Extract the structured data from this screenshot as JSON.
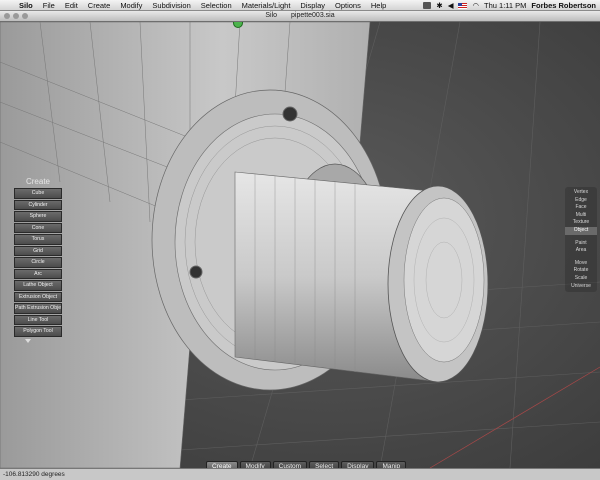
{
  "menubar": {
    "app_name": "Silo",
    "items": [
      "File",
      "Edit",
      "Create",
      "Modify",
      "Subdivision",
      "Selection",
      "Materials/Light",
      "Display",
      "Options",
      "Help"
    ],
    "clock": "Thu 1:11 PM",
    "user": "Forbes Robertson"
  },
  "window": {
    "app": "Silo",
    "document": "pipette003.sia"
  },
  "create_panel": {
    "title": "Create",
    "buttons": [
      "Cube",
      "Cylinder",
      "Sphere",
      "Cone",
      "Torus",
      "Grid",
      "Circle",
      "Arc",
      "Lathe Object",
      "Extrusion Object",
      "Path Extrusion Object",
      "Line Tool",
      "Polygon Tool"
    ]
  },
  "mode_panel": {
    "selection_modes": [
      "Vertex",
      "Edge",
      "Face",
      "Multi",
      "Texture",
      "Object"
    ],
    "active_mode": "Object",
    "paint_modes": [
      "Paint",
      "Area"
    ],
    "transform_modes": [
      "Move",
      "Rotate",
      "Scale",
      "Universe"
    ]
  },
  "bottom_tabs": {
    "items": [
      "Create",
      "Modify",
      "Custom",
      "Select",
      "Display",
      "Manip"
    ],
    "active": "Create"
  },
  "status": {
    "text": "-106.813290 degrees"
  },
  "colors": {
    "viewport_bg": "#4a4a4a",
    "mesh_fill": "#cfcfcf",
    "wire": "#6a6a6a"
  }
}
